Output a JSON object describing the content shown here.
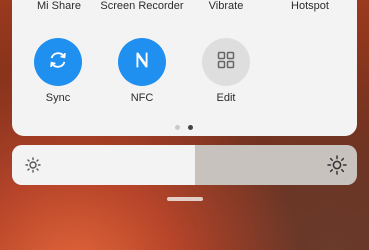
{
  "top_row": {
    "items": [
      {
        "label": "Mi Share"
      },
      {
        "label": "Screen Recorder"
      },
      {
        "label": "Vibrate"
      },
      {
        "label": "Hotspot"
      }
    ]
  },
  "tiles": [
    {
      "label": "Sync",
      "icon": "sync-icon",
      "state": "on"
    },
    {
      "label": "NFC",
      "icon": "nfc-icon",
      "state": "on"
    },
    {
      "label": "Edit",
      "icon": "grid-icon",
      "state": "off"
    }
  ],
  "pager": {
    "pages": 2,
    "active_page": 2
  },
  "brightness": {
    "level_percent": 53
  },
  "colors": {
    "accent": "#1f8ff0",
    "panel": "#f3f3f3",
    "inactive_tile": "#dedede"
  }
}
